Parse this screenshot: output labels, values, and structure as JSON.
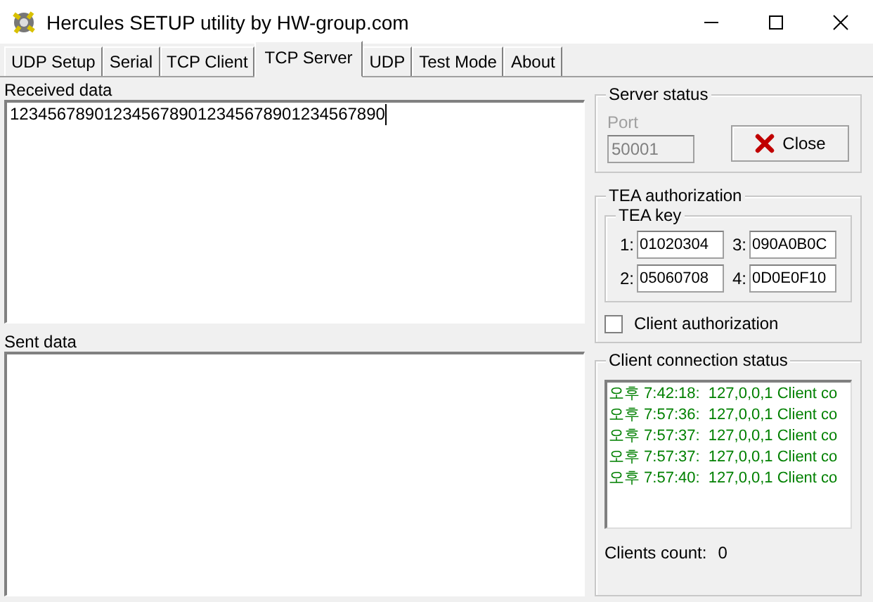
{
  "window": {
    "title": "Hercules SETUP utility by HW-group.com"
  },
  "tabs": [
    {
      "label": "UDP Setup",
      "selected": false
    },
    {
      "label": "Serial",
      "selected": false
    },
    {
      "label": "TCP Client",
      "selected": false
    },
    {
      "label": "TCP Server",
      "selected": true
    },
    {
      "label": "UDP",
      "selected": false
    },
    {
      "label": "Test Mode",
      "selected": false
    },
    {
      "label": "About",
      "selected": false
    }
  ],
  "received": {
    "label": "Received data",
    "text": "1234567890123456789012345678901234567890"
  },
  "sent": {
    "label": "Sent data"
  },
  "server_status": {
    "title": "Server status",
    "port_label": "Port",
    "port_value": "50001",
    "port_disabled": true,
    "close_button": "Close"
  },
  "tea": {
    "title": "TEA authorization",
    "key_title": "TEA key",
    "keys": [
      {
        "index": "1:",
        "value": "01020304"
      },
      {
        "index": "3:",
        "value": "090A0B0C"
      },
      {
        "index": "2:",
        "value": "05060708"
      },
      {
        "index": "4:",
        "value": "0D0E0F10"
      }
    ],
    "client_auth": {
      "label": "Client authorization",
      "checked": false
    }
  },
  "clients": {
    "title": "Client connection status",
    "log": [
      "오후 7:42:18:  127,0,0,1 Client co",
      "오후 7:57:36:  127,0,0,1 Client co",
      "오후 7:57:37:  127,0,0,1 Client co",
      "오후 7:57:37:  127,0,0,1 Client co",
      "오후 7:57:40:  127,0,0,1 Client co"
    ],
    "count_label": "Clients count:",
    "count_value": "0"
  }
}
